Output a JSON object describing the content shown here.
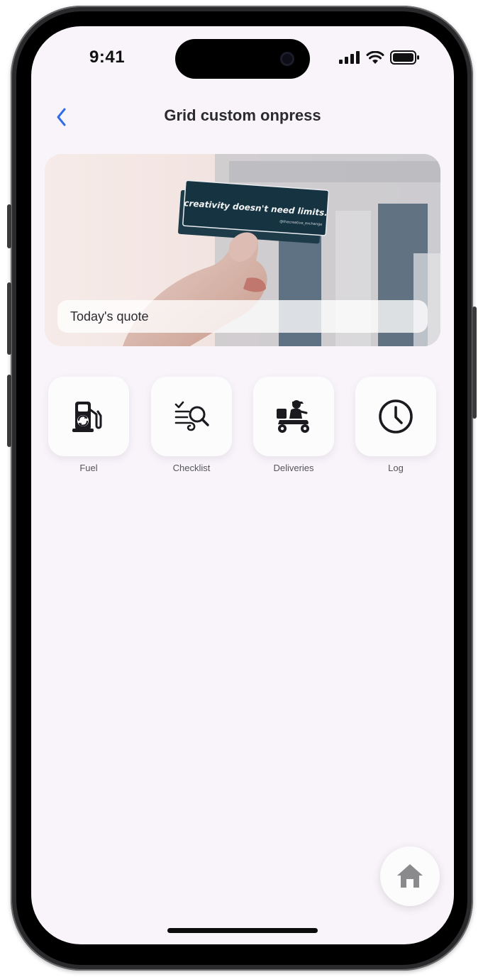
{
  "status_bar": {
    "time": "9:41"
  },
  "nav": {
    "title": "Grid custom onpress"
  },
  "hero": {
    "card_text": "creativity doesn't need limits.",
    "card_handle": "@thecreative_exchange",
    "quote_label": "Today's quote"
  },
  "grid": {
    "items": [
      {
        "label": "Fuel",
        "icon": "fuel-pump-icon"
      },
      {
        "label": "Checklist",
        "icon": "checklist-search-icon"
      },
      {
        "label": "Deliveries",
        "icon": "delivery-scooter-icon"
      },
      {
        "label": "Log",
        "icon": "clock-icon"
      }
    ]
  },
  "colors": {
    "accent": "#2f6ee6",
    "background": "#f8f4fa",
    "icon": "#1b1b1f",
    "home_icon": "#8a8a8c"
  }
}
